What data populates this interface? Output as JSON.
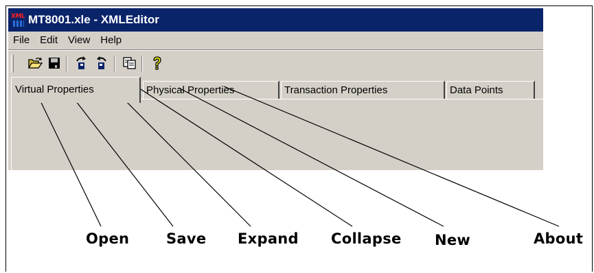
{
  "window": {
    "title": "MT8001.xle - XMLEditor",
    "icon": "xml-app-icon"
  },
  "menu": [
    "File",
    "Edit",
    "View",
    "Help"
  ],
  "toolbar": {
    "buttons": [
      {
        "name": "open",
        "icon": "folder-open-icon"
      },
      {
        "name": "save",
        "icon": "floppy-disk-icon"
      },
      {
        "name": "expand",
        "icon": "expand-icon"
      },
      {
        "name": "collapse",
        "icon": "collapse-icon"
      },
      {
        "name": "new",
        "icon": "copy-document-icon"
      },
      {
        "name": "about",
        "icon": "question-mark-icon"
      }
    ]
  },
  "tabs": [
    {
      "label": "Virtual Properties",
      "active": true
    },
    {
      "label": "Physical Properties",
      "active": false
    },
    {
      "label": "Transaction Properties",
      "active": false
    },
    {
      "label": "Data Points",
      "active": false
    }
  ],
  "callouts": {
    "open": "Open",
    "save": "Save",
    "expand": "Expand",
    "collapse": "Collapse",
    "new": "New",
    "about": "About"
  },
  "colors": {
    "titlebar": "#0a246a",
    "chrome": "#d4d0c8",
    "about_icon": "#ffff00"
  }
}
